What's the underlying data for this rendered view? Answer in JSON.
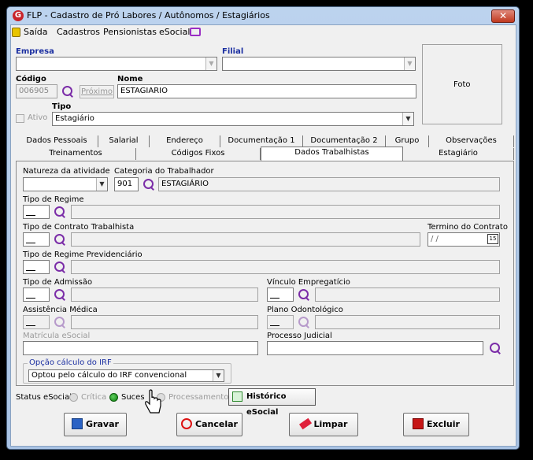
{
  "window": {
    "title": "FLP - Cadastro de Pró Labores / Autônomos / Estagiários",
    "close": "✕"
  },
  "menu": {
    "saida": "Saída",
    "cadastros": "Cadastros",
    "pensionistas": "Pensionistas",
    "esocial": "eSocial"
  },
  "header": {
    "empresa_label": "Empresa",
    "filial_label": "Filial",
    "codigo_label": "Código",
    "codigo_value": "006905",
    "proximo": "Próximo",
    "nome_label": "Nome",
    "nome_value": "ESTAGIARIO",
    "tipo_label": "Tipo",
    "tipo_value": "Estagiário",
    "ativo_label": "Ativo",
    "foto_label": "Foto"
  },
  "tabs_row1": [
    "Dados Pessoais",
    "Salarial",
    "Endereço",
    "Documentação 1",
    "Documentação 2",
    "Grupo",
    "Observações"
  ],
  "tabs_row2": [
    "Treinamentos",
    "Códigos Fixos",
    "Dados Trabalhistas",
    "Estagiário"
  ],
  "form": {
    "natureza_label": "Natureza da atividade",
    "categoria_label": "Categoria do Trabalhador",
    "categoria_code": "901",
    "categoria_desc": "ESTAGIÁRIO",
    "tipo_regime_label": "Tipo de Regime",
    "tipo_contrato_label": "Tipo de Contrato Trabalhista",
    "termino_label": "Termino do Contrato",
    "termino_value": "/ /",
    "termino_btn": "15",
    "regime_prev_label": "Tipo de Regime Previdenciário",
    "admissao_label": "Tipo de Admissão",
    "vinculo_label": "Vínculo Empregatício",
    "assistencia_label": "Assistência Médica",
    "plano_label": "Plano Odontológico",
    "matricula_label": "Matrícula eSocial",
    "processo_label": "Processo Judicial",
    "irf_group": "Opção cálculo do IRF",
    "irf_value": "Optou pelo cálculo do IRF convencional"
  },
  "status": {
    "label": "Status eSocial:",
    "critica": "Crítica",
    "sucesso": "Suces",
    "processamento": "Processamento",
    "historico": "Histórico eSocial"
  },
  "buttons": {
    "gravar": "Gravar",
    "cancelar": "Cancelar",
    "limpar": "Limpar",
    "excluir": "Excluir"
  }
}
